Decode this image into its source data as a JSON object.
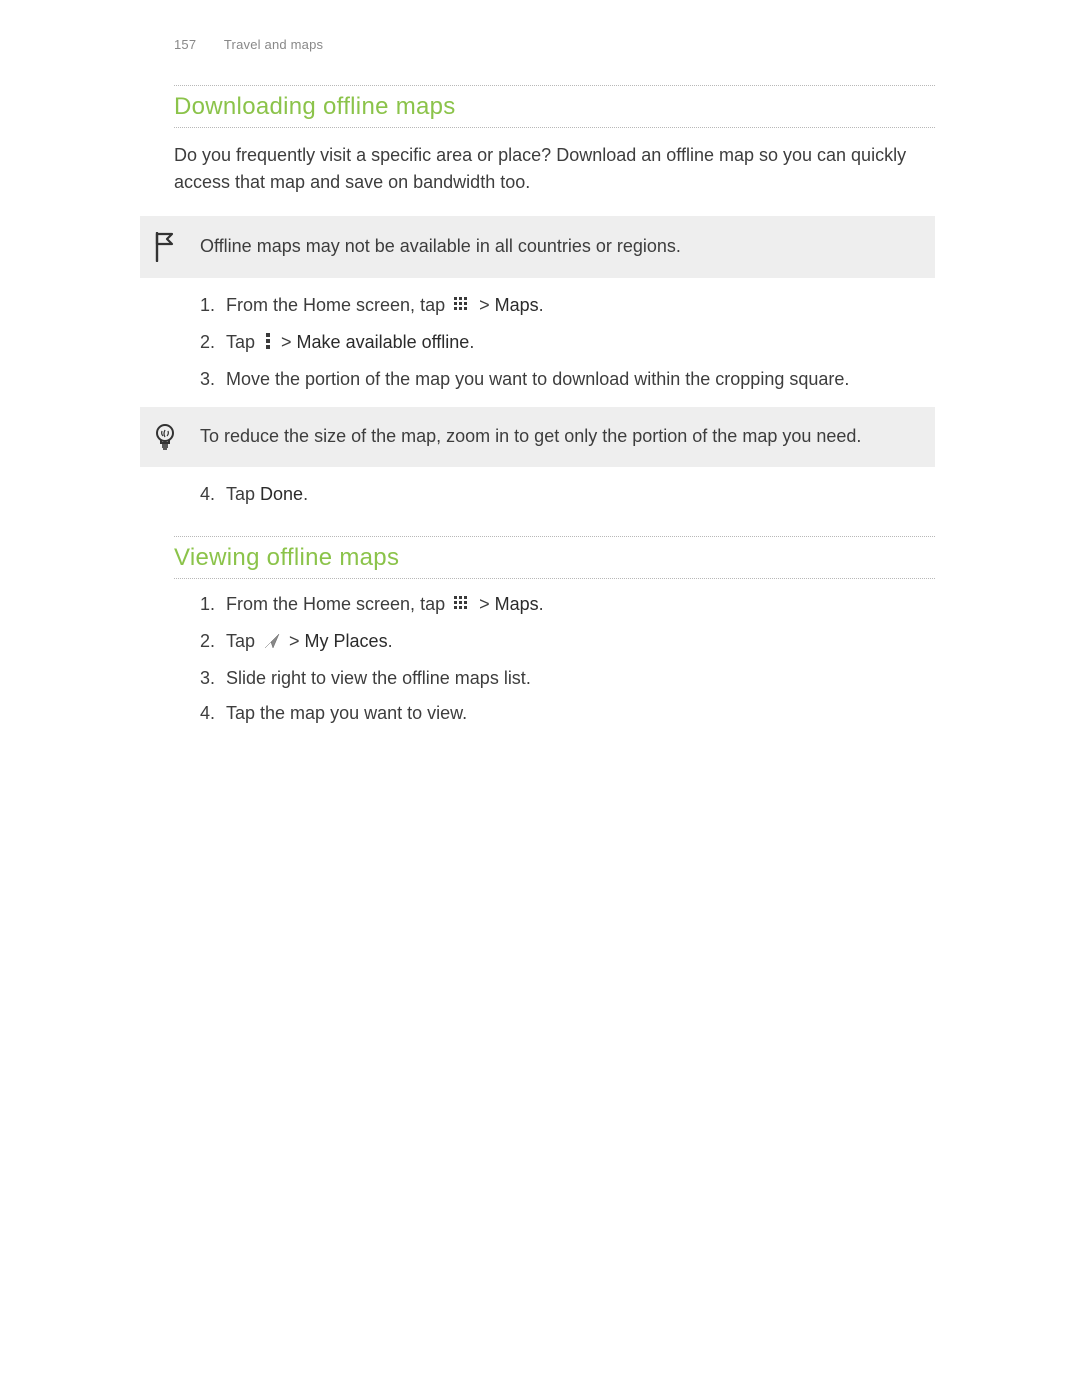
{
  "header": {
    "page_number": "157",
    "section": "Travel and maps"
  },
  "sections": [
    {
      "title": "Downloading offline maps",
      "intro": "Do you frequently visit a specific area or place? Download an offline map so you can quickly access that map and save on bandwidth too.",
      "flag_note": "Offline maps may not be available in all countries or regions.",
      "steps_a": {
        "s1_pre": "From the Home screen, tap ",
        "s1_post": " > ",
        "s1_bold": "Maps",
        "s1_end": ".",
        "s2_pre": "Tap ",
        "s2_post": " > ",
        "s2_bold": "Make available offline",
        "s2_end": ".",
        "s3": "Move the portion of the map you want to download within the cropping square."
      },
      "tip_note": "To reduce the size of the map, zoom in to get only the portion of the map you need.",
      "steps_b": {
        "s4_pre": "Tap ",
        "s4_bold": "Done",
        "s4_end": "."
      }
    },
    {
      "title": "Viewing offline maps",
      "steps": {
        "s1_pre": "From the Home screen, tap ",
        "s1_post": " > ",
        "s1_bold": "Maps",
        "s1_end": ".",
        "s2_pre": "Tap ",
        "s2_post": " > ",
        "s2_bold": "My Places",
        "s2_end": ".",
        "s3": "Slide right to view the offline maps list.",
        "s4": "Tap the map you want to view."
      }
    }
  ]
}
